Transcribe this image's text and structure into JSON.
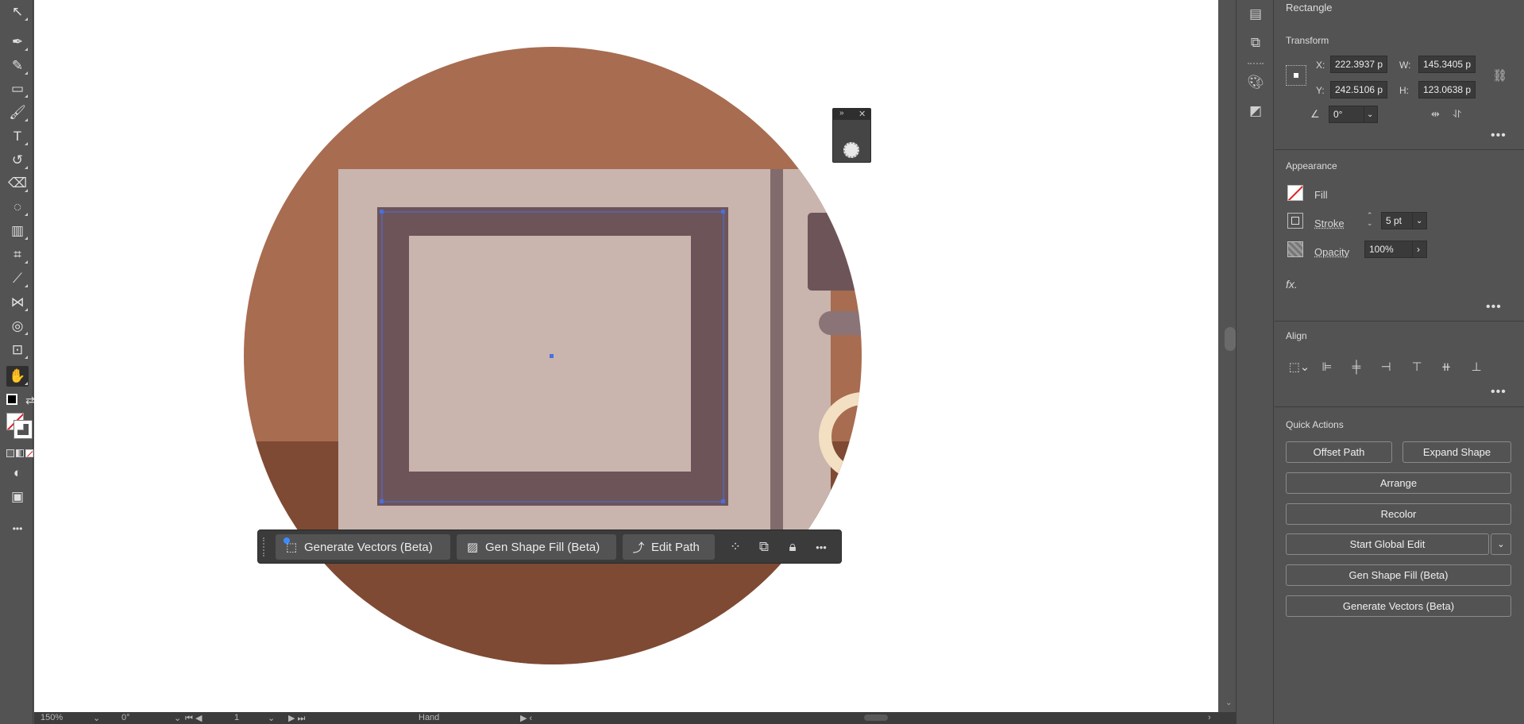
{
  "toolbar": {
    "tools": [
      {
        "name": "direct-selection-icon",
        "glyph": "↖"
      },
      {
        "name": "pen-icon",
        "glyph": "✒"
      },
      {
        "name": "curvature-icon",
        "glyph": "✎"
      },
      {
        "name": "rectangle-icon",
        "glyph": "▭"
      },
      {
        "name": "paintbrush-icon",
        "glyph": "🖌"
      },
      {
        "name": "type-icon",
        "glyph": "T"
      },
      {
        "name": "rotate-icon",
        "glyph": "↺"
      },
      {
        "name": "eraser-icon",
        "glyph": "⌫"
      },
      {
        "name": "lasso-icon",
        "glyph": "◌"
      },
      {
        "name": "gradient-icon",
        "glyph": "▥"
      },
      {
        "name": "mesh-icon",
        "glyph": "⌗"
      },
      {
        "name": "eyedropper-icon",
        "glyph": "⟋"
      },
      {
        "name": "blend-icon",
        "glyph": "⋈"
      },
      {
        "name": "shape-builder-icon",
        "glyph": "◎"
      },
      {
        "name": "artboard-icon",
        "glyph": "⊡"
      },
      {
        "name": "hand-icon",
        "glyph": "✋"
      }
    ],
    "more_label": "•••"
  },
  "float_panel": {
    "expand": "»",
    "close": "✕"
  },
  "context_bar": {
    "generate_vectors": "Generate Vectors (Beta)",
    "gen_shape_fill": "Gen Shape Fill (Beta)",
    "edit_path": "Edit Path",
    "more": "•••"
  },
  "status": {
    "zoom": "150%",
    "rotation": "0°",
    "artboard_num": "1",
    "tool_name": "Hand"
  },
  "properties": {
    "object_type": "Rectangle",
    "transform": {
      "title": "Transform",
      "x_label": "X:",
      "x": "222.3937 p",
      "y_label": "Y:",
      "y": "242.5106 p",
      "w_label": "W:",
      "w": "145.3405 p",
      "h_label": "H:",
      "h": "123.0638 p",
      "angle": "0°"
    },
    "appearance": {
      "title": "Appearance",
      "fill_label": "Fill",
      "stroke_label": "Stroke",
      "stroke_value": "5 pt",
      "opacity_label": "Opacity",
      "opacity_value": "100%",
      "fx_label": "fx."
    },
    "align": {
      "title": "Align"
    },
    "quick_actions": {
      "title": "Quick Actions",
      "offset_path": "Offset Path",
      "expand_shape": "Expand Shape",
      "arrange": "Arrange",
      "recolor": "Recolor",
      "start_global_edit": "Start Global Edit",
      "gen_shape_fill": "Gen Shape Fill (Beta)",
      "generate_vectors": "Generate Vectors (Beta)"
    },
    "more": "•••"
  },
  "colors": {
    "artwork_bg_circle": "#a86c50",
    "artwork_floor": "#7e4a34",
    "artwork_panel": "#c9b4ae",
    "artwork_frame": "#6d5459",
    "selection_blue": "#4a6ee0",
    "ring_cream": "#f3dfc1"
  }
}
